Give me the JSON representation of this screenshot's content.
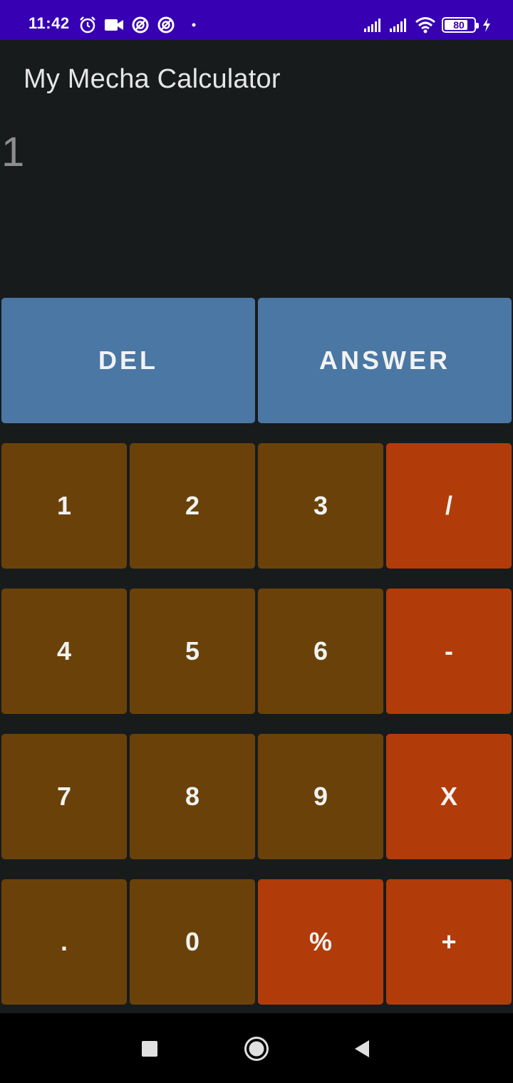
{
  "status_bar": {
    "time": "11:42",
    "battery_level": "80",
    "battery_fraction": 0.8,
    "icons_left": [
      "alarm-icon",
      "video-camera-icon",
      "sync-icon",
      "sync-icon",
      "dot-icon"
    ],
    "icons_right": [
      "signal-icon",
      "signal-icon",
      "wifi-icon",
      "battery-icon",
      "charging-icon"
    ]
  },
  "app": {
    "title": "My Mecha Calculator",
    "display_value": "1"
  },
  "buttons": {
    "del": "DEL",
    "answer": "ANSWER",
    "one": "1",
    "two": "2",
    "three": "3",
    "divide": "/",
    "four": "4",
    "five": "5",
    "six": "6",
    "minus": "-",
    "seven": "7",
    "eight": "8",
    "nine": "9",
    "multiply": "X",
    "dot": ".",
    "zero": "0",
    "percent": "%",
    "plus": "+"
  },
  "nav_bar": {
    "icons": [
      "recents-icon",
      "home-icon",
      "back-icon"
    ]
  },
  "colors": {
    "status_bar": "#3700b3",
    "background": "#171b1c",
    "top_button": "#4a77a4",
    "number_button": "#6a4209",
    "operator_button": "#b23c09"
  }
}
